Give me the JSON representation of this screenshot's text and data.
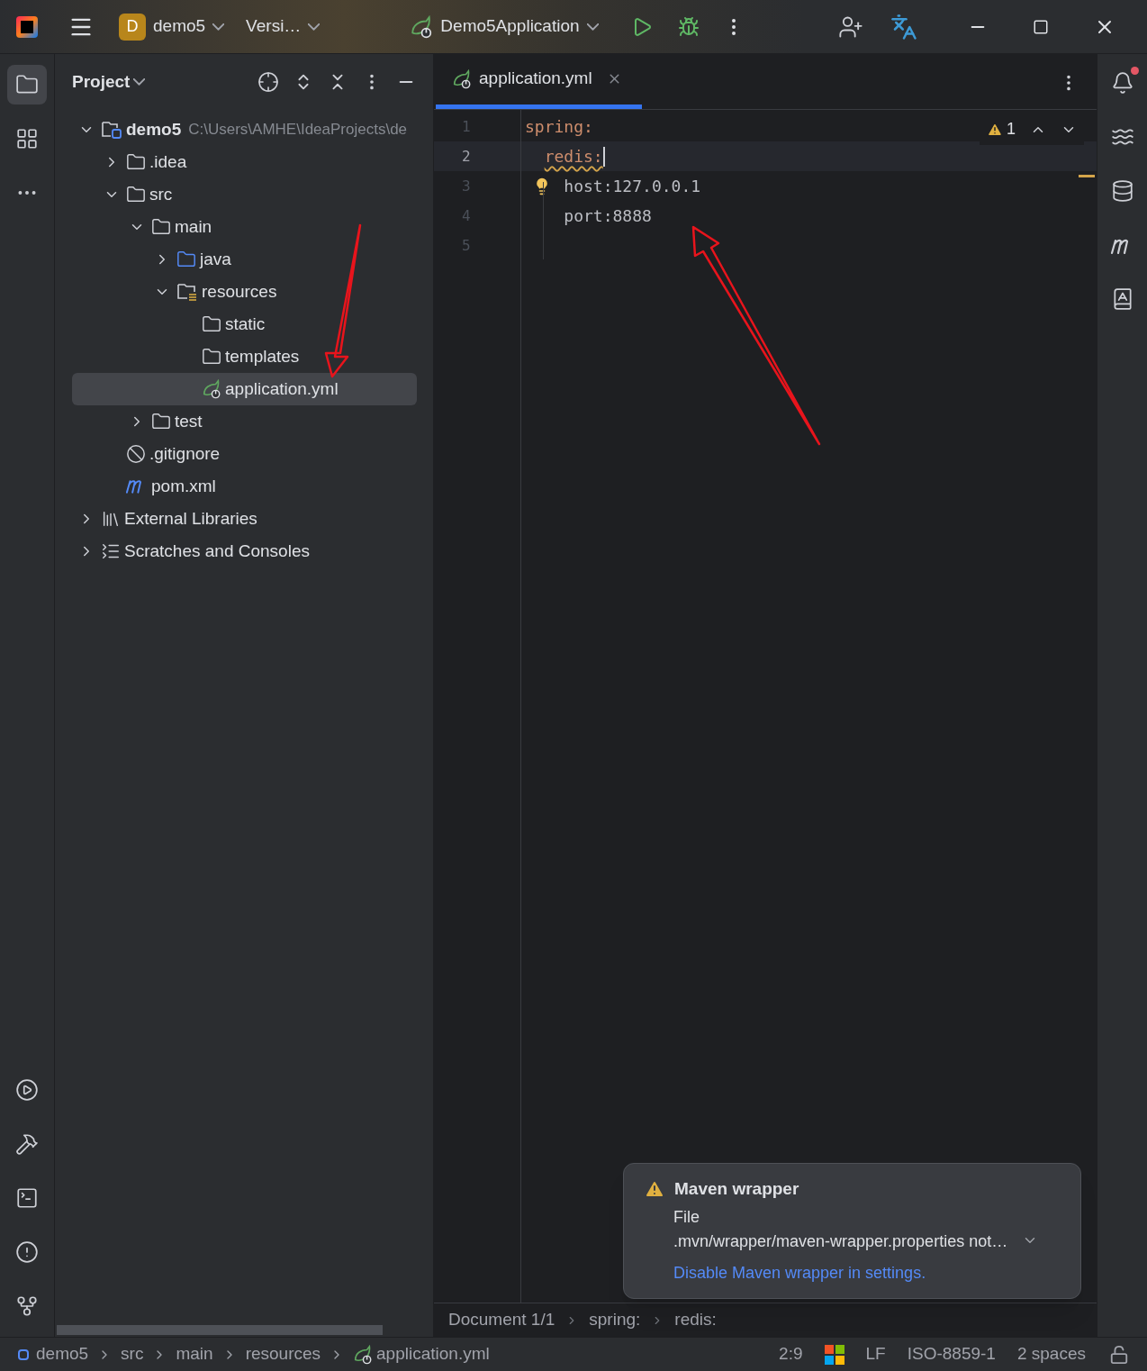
{
  "title_bar": {
    "project_initial": "D",
    "project": "demo5",
    "vcs": "Versi…",
    "run_config": "Demo5Application"
  },
  "project_panel": {
    "title": "Project",
    "tree": [
      {
        "label": "demo5",
        "path": "C:\\Users\\AMHE\\IdeaProjects\\de",
        "kind": "module",
        "expanded": true,
        "selected": false,
        "children": [
          {
            "label": ".idea",
            "kind": "folder",
            "expanded": false,
            "selected": false
          },
          {
            "label": "src",
            "kind": "folder",
            "expanded": true,
            "selected": false,
            "children": [
              {
                "label": "main",
                "kind": "folder",
                "expanded": true,
                "selected": false,
                "children": [
                  {
                    "label": "java",
                    "kind": "source-folder",
                    "expanded": false,
                    "selected": false
                  },
                  {
                    "label": "resources",
                    "kind": "resources-folder",
                    "expanded": true,
                    "selected": false,
                    "children": [
                      {
                        "label": "static",
                        "kind": "folder",
                        "selected": false
                      },
                      {
                        "label": "templates",
                        "kind": "folder",
                        "selected": false
                      },
                      {
                        "label": "application.yml",
                        "kind": "spring-file",
                        "selected": true
                      }
                    ]
                  }
                ]
              },
              {
                "label": "test",
                "kind": "folder",
                "expanded": false,
                "selected": false
              }
            ]
          },
          {
            "label": ".gitignore",
            "kind": "ignore-file",
            "selected": false
          },
          {
            "label": "pom.xml",
            "kind": "maven-file",
            "selected": false
          }
        ]
      },
      {
        "label": "External Libraries",
        "kind": "libraries",
        "expanded": false,
        "selected": false
      },
      {
        "label": "Scratches and Consoles",
        "kind": "scratches",
        "expanded": false,
        "selected": false
      }
    ]
  },
  "editor": {
    "tabs": [
      {
        "label": "application.yml",
        "selected": true
      }
    ],
    "inspection_count": "1",
    "lines": [
      {
        "number": "1",
        "text": "spring:",
        "kind": "key",
        "current": false,
        "squiggle": false,
        "hint": false
      },
      {
        "number": "2",
        "text": "  redis:",
        "kind": "key",
        "current": true,
        "squiggle": true,
        "hint": false
      },
      {
        "number": "3",
        "text": "    host:127.0.0.1",
        "kind": "plain",
        "current": false,
        "squiggle": false,
        "hint": true
      },
      {
        "number": "4",
        "text": "    port:8888",
        "kind": "plain",
        "current": false,
        "squiggle": false,
        "hint": false
      },
      {
        "number": "5",
        "current": false
      }
    ],
    "breadcrumbs": [
      "Document 1/1",
      "spring:",
      "redis:"
    ]
  },
  "notification": {
    "title": "Maven wrapper",
    "body": [
      "File",
      ".mvn/wrapper/maven-wrapper.properties not…"
    ],
    "link": "Disable Maven wrapper in settings."
  },
  "right_strip": {
    "unread_notifications": true
  },
  "status_bar": {
    "path": [
      {
        "label": "demo5",
        "kind": "module"
      },
      {
        "label": "src",
        "kind": "folder"
      },
      {
        "label": "main",
        "kind": "folder"
      },
      {
        "label": "resources",
        "kind": "folder"
      },
      {
        "label": "application.yml",
        "kind": "spring-file"
      }
    ],
    "position": "2:9",
    "line_separator": "LF",
    "encoding": "ISO-8859-1",
    "indent": "2 spaces"
  }
}
